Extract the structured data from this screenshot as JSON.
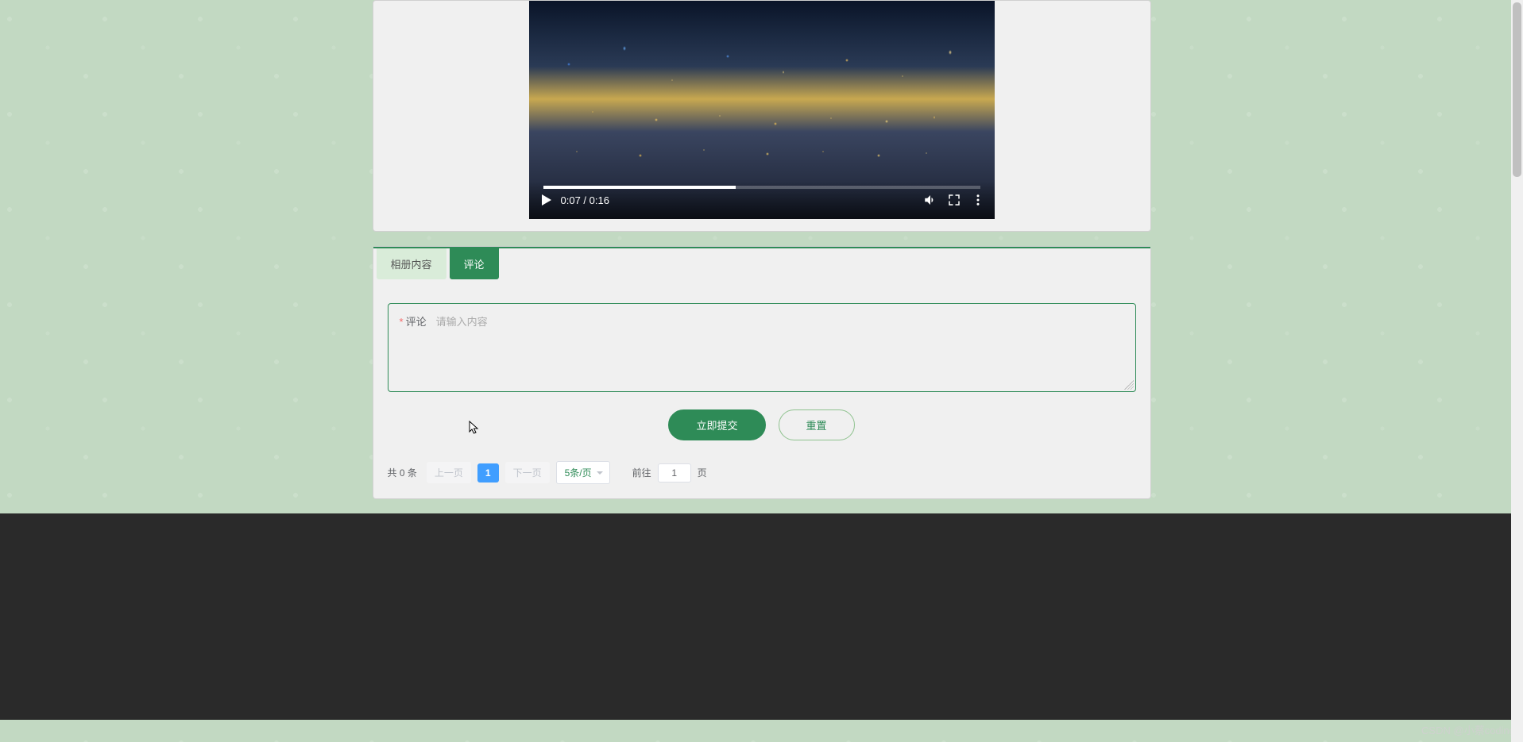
{
  "video": {
    "currentTime": "0:07",
    "duration": "0:16",
    "timeDisplay": "0:07 / 0:16",
    "progressPercent": 44
  },
  "tabs": {
    "album": "相册内容",
    "comments": "评论"
  },
  "commentForm": {
    "label": "评论",
    "placeholder": "请输入内容"
  },
  "buttons": {
    "submit": "立即提交",
    "reset": "重置"
  },
  "pagination": {
    "totalPrefix": "共",
    "totalCount": "0",
    "totalSuffix": "条",
    "prev": "上一页",
    "current": "1",
    "next": "下一页",
    "pageSize": "5条/页",
    "jumpPrefix": "前往",
    "jumpValue": "1",
    "jumpSuffix": "页"
  },
  "watermark": "CSDN @小蔡coding",
  "colors": {
    "primary": "#2e8b57",
    "pageActive": "#409eff"
  }
}
